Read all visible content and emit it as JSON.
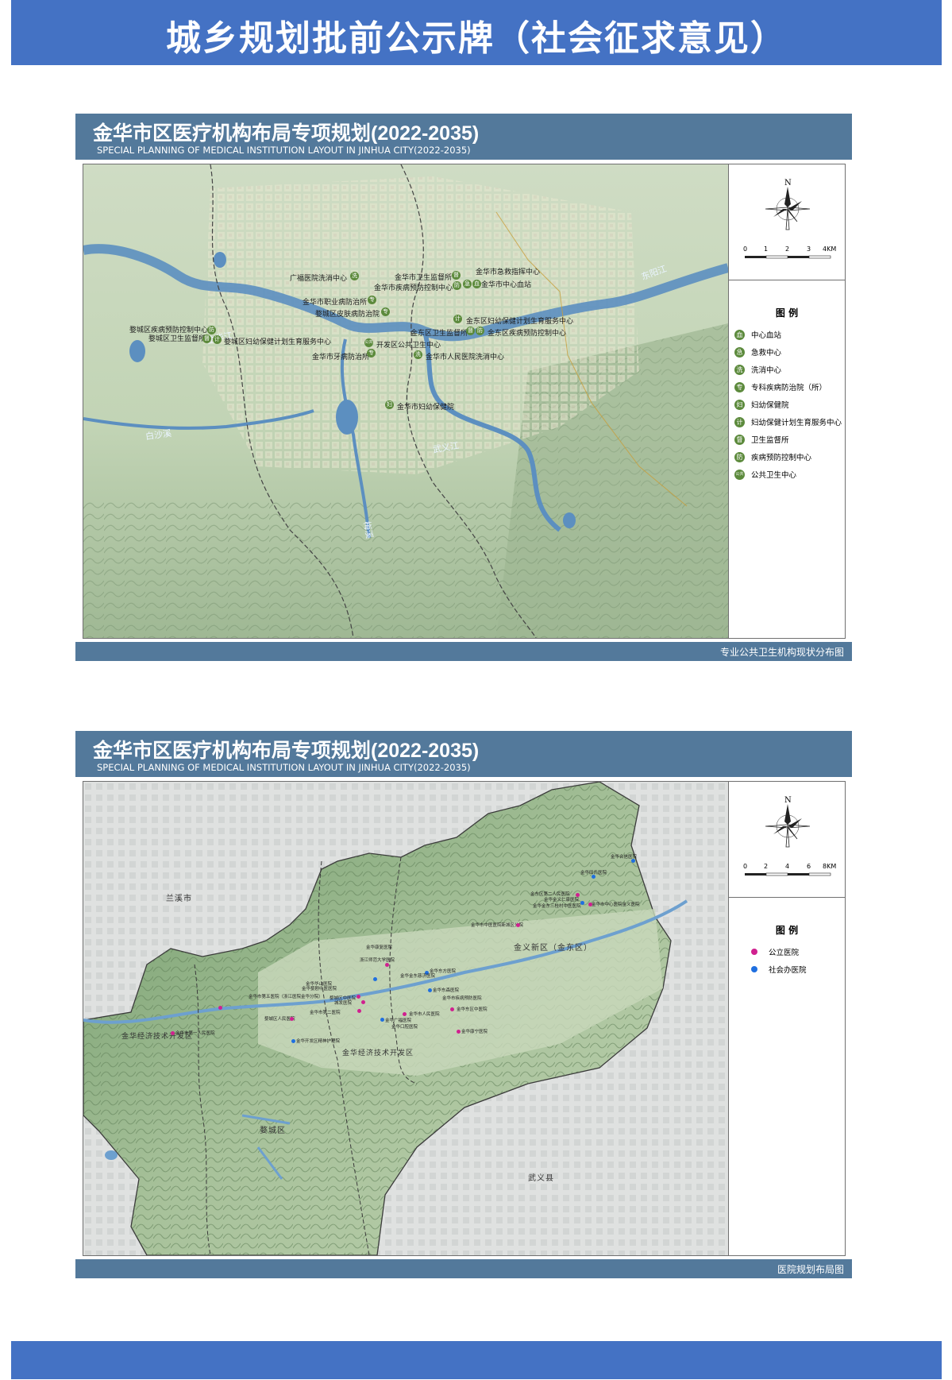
{
  "header_banner": {
    "title": "城乡规划批前公示牌（社会征求意见）"
  },
  "colors": {
    "banner": "#4472c4",
    "panel_bar": "#53799b",
    "legend_marker": "#5c8a3c",
    "public_hospital": "#d0208f",
    "private_hospital": "#1f6fe0"
  },
  "panels": [
    {
      "title": "金华市区医疗机构布局专项规划(2022-2035)",
      "subtitle": "SPECIAL PLANNING OF MEDICAL INSTITUTION LAYOUT IN JINHUA CITY(2022-2035)",
      "footer": "专业公共卫生机构现状分布图",
      "compass_n": "N",
      "scale_labels": [
        "0",
        "1",
        "2",
        "3",
        "4KM"
      ],
      "legend_title": "图 例",
      "legend": [
        {
          "icon": "血",
          "label": "中心血站"
        },
        {
          "icon": "急",
          "label": "急救中心"
        },
        {
          "icon": "洗",
          "label": "洗消中心"
        },
        {
          "icon": "专",
          "label": "专科疾病防治院（所）"
        },
        {
          "icon": "妇",
          "label": "妇幼保健院"
        },
        {
          "icon": "计",
          "label": "妇幼保健计划生育服务中心"
        },
        {
          "icon": "督",
          "label": "卫生监督所"
        },
        {
          "icon": "防",
          "label": "疾病预防控制中心"
        },
        {
          "icon": "公共",
          "label": "公共卫生中心"
        }
      ],
      "map_labels": [
        {
          "text": "广福医院洗消中心",
          "icon": "洗"
        },
        {
          "text": "金华市卫生监督所",
          "icon": "督"
        },
        {
          "text": "金华市急救指挥中心",
          "icon": "急"
        },
        {
          "text": "金华市疾病预防控制中心",
          "icon": "防"
        },
        {
          "text": "金华市中心血站",
          "icon": "血"
        },
        {
          "text": "金华市职业病防治所",
          "icon": "专"
        },
        {
          "text": "婺城区皮肤病防治院",
          "icon": "专"
        },
        {
          "text": "金东区妇幼保健计划生育服务中心",
          "icon": "计"
        },
        {
          "text": "婺城区疾病预防控制中心",
          "icon": "防"
        },
        {
          "text": "婺城区卫生监督所",
          "icon": "督"
        },
        {
          "text": "金东区卫生监督所",
          "icon": "督"
        },
        {
          "text": "金东区疾病预防控制中心",
          "icon": "防"
        },
        {
          "text": "婺城区妇幼保健计划生育服务中心",
          "icon": "计"
        },
        {
          "text": "开发区公共卫生中心",
          "icon": "公共"
        },
        {
          "text": "金华市牙病防治所",
          "icon": "专"
        },
        {
          "text": "金华市人民医院洗消中心",
          "icon": "洗"
        },
        {
          "text": "金华市妇幼保健院",
          "icon": "妇"
        }
      ],
      "rivers": [
        "金华江",
        "东阳江",
        "白沙溪",
        "武义江",
        "梅溪"
      ]
    },
    {
      "title": "金华市区医疗机构布局专项规划(2022-2035)",
      "subtitle": "SPECIAL PLANNING OF MEDICAL INSTITUTION LAYOUT IN JINHUA CITY(2022-2035)",
      "footer": "医院规划布局图",
      "compass_n": "N",
      "scale_labels": [
        "0",
        "2",
        "4",
        "6",
        "8KM"
      ],
      "legend_title": "图 例",
      "legend": [
        {
          "color": "#d0208f",
          "label": "公立医院"
        },
        {
          "color": "#1f6fe0",
          "label": "社会办医院"
        }
      ],
      "places": [
        "兰溪市",
        "金义新区（金东区）",
        "金华经济技术开发区",
        "金华经济技术开发区",
        "婺城区",
        "武义县"
      ],
      "hospitals": [
        "金华合信医院",
        "金华田氏医院",
        "金东区第二人民医院",
        "金华金义仁康医院",
        "金华市中心医院金义医院",
        "金华金东三桂村中医医院",
        "金华市中医医院新城区分院",
        "金华康复医院",
        "浙江师范大学医院",
        "金华东方医院",
        "城发医院",
        "金华金东慈济医院",
        "金华东森医院",
        "金华市第五医院（浙江医院金华分院）",
        "婺城区中医院",
        "金华婺剧中医医院",
        "金华华山医院",
        "金华市第二医院",
        "婺城区人民医院",
        "金华广福医院",
        "金华口腔医院",
        "金华市人民医院",
        "金华东区中医院",
        "金华市疾病预防医院",
        "金华开发区精神护理院",
        "金华市第一人民医院",
        "金华康宁医院"
      ]
    }
  ]
}
